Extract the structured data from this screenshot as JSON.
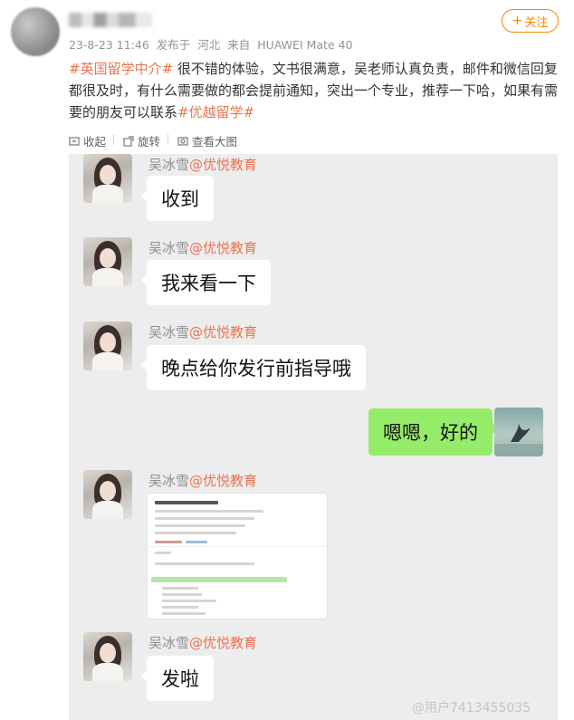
{
  "post": {
    "timestamp": "23-8-23 11:46",
    "posted_from_label": "发布于",
    "location": "河北",
    "source_label": "来自",
    "device": "HUAWEI Mate 40",
    "follow_label": "关注",
    "follow_plus": "+",
    "hashtag1": "#英国留学中介#",
    "body": " 很不错的体验，文书很满意，吴老师认真负责，邮件和微信回复都很及时，有什么需要做的都会提前通知，突出一个专业，推荐一下哈，如果有需要的朋友可以联系",
    "hashtag2": "#优越留学#"
  },
  "toolbar": {
    "collapse_label": "收起",
    "rotate_label": "旋转",
    "view_large_label": "查看大图"
  },
  "chat": {
    "messages": [
      {
        "sender_name": "吴冰雪",
        "sender_org": "@优悦教育",
        "text": "收到"
      },
      {
        "sender_name": "吴冰雪",
        "sender_org": "@优悦教育",
        "text": "我来看一下"
      },
      {
        "sender_name": "吴冰雪",
        "sender_org": "@优悦教育",
        "text": "晚点给你发行前指导哦"
      },
      {
        "self": true,
        "text": "嗯嗯，好的"
      },
      {
        "sender_name": "吴冰雪",
        "sender_org": "@优悦教育",
        "attachment": "document-image"
      },
      {
        "sender_name": "吴冰雪",
        "sender_org": "@优悦教育",
        "text": "发啦"
      }
    ]
  },
  "watermark": "@用户7413455035",
  "colors": {
    "accent_orange": "#ff8200",
    "hashtag": "#eb7350",
    "bubble_green": "#95ec69",
    "chat_bg": "#ededed"
  },
  "icons": [
    "collapse-icon",
    "rotate-icon",
    "view-large-icon"
  ]
}
